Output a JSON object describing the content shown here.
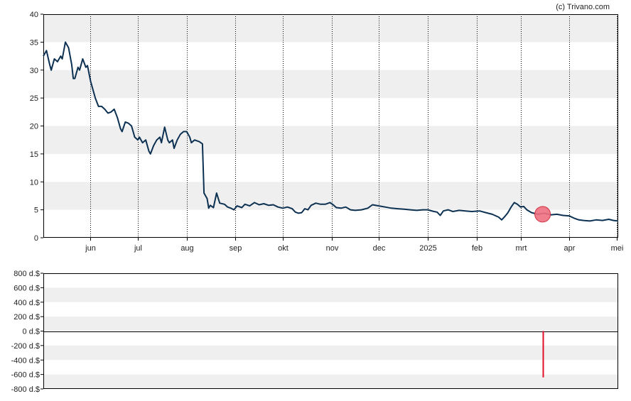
{
  "credit": "(c) Trivano.com",
  "colors": {
    "price_line": "#0d3152",
    "band": "#efefef",
    "marker_fill": "#f07080",
    "marker_stroke": "#d03040",
    "volume_bar": "#e0102a",
    "axis": "#000000"
  },
  "chart_data": [
    {
      "type": "line",
      "ylim": [
        0,
        40
      ],
      "y_ticks": [
        0,
        5,
        10,
        15,
        20,
        25,
        30,
        35,
        40
      ],
      "x_range": [
        "2024-05-02",
        "2025-05-02"
      ],
      "x_ticks": [
        {
          "label": "jun",
          "date": "2024-06-01"
        },
        {
          "label": "jul",
          "date": "2024-07-01"
        },
        {
          "label": "aug",
          "date": "2024-08-01"
        },
        {
          "label": "sep",
          "date": "2024-09-01"
        },
        {
          "label": "okt",
          "date": "2024-10-01"
        },
        {
          "label": "nov",
          "date": "2024-11-01"
        },
        {
          "label": "dec",
          "date": "2024-12-01"
        },
        {
          "label": "2025",
          "date": "2025-01-01"
        },
        {
          "label": "feb",
          "date": "2025-02-01"
        },
        {
          "label": "mrt",
          "date": "2025-03-01"
        },
        {
          "label": "apr",
          "date": "2025-04-01"
        },
        {
          "label": "mei",
          "date": "2025-05-01"
        }
      ],
      "grid": true,
      "series": [
        {
          "points": [
            [
              "2024-05-02",
              32.5
            ],
            [
              "2024-05-04",
              33.5
            ],
            [
              "2024-05-06",
              31.0
            ],
            [
              "2024-05-07",
              30.0
            ],
            [
              "2024-05-09",
              32.0
            ],
            [
              "2024-05-11",
              31.5
            ],
            [
              "2024-05-13",
              32.5
            ],
            [
              "2024-05-14",
              32.0
            ],
            [
              "2024-05-16",
              35.0
            ],
            [
              "2024-05-18",
              34.0
            ],
            [
              "2024-05-20",
              31.0
            ],
            [
              "2024-05-21",
              28.5
            ],
            [
              "2024-05-22",
              28.5
            ],
            [
              "2024-05-24",
              30.5
            ],
            [
              "2024-05-25",
              30.0
            ],
            [
              "2024-05-27",
              32.0
            ],
            [
              "2024-05-29",
              30.5
            ],
            [
              "2024-05-30",
              30.8
            ],
            [
              "2024-06-01",
              28.0
            ],
            [
              "2024-06-04",
              25.0
            ],
            [
              "2024-06-06",
              23.5
            ],
            [
              "2024-06-08",
              23.5
            ],
            [
              "2024-06-10",
              23.0
            ],
            [
              "2024-06-12",
              22.3
            ],
            [
              "2024-06-14",
              22.5
            ],
            [
              "2024-06-16",
              23.0
            ],
            [
              "2024-06-18",
              21.5
            ],
            [
              "2024-06-20",
              19.5
            ],
            [
              "2024-06-21",
              19.0
            ],
            [
              "2024-06-23",
              20.7
            ],
            [
              "2024-06-25",
              20.5
            ],
            [
              "2024-06-27",
              20.0
            ],
            [
              "2024-06-29",
              18.0
            ],
            [
              "2024-07-01",
              17.5
            ],
            [
              "2024-07-02",
              18.0
            ],
            [
              "2024-07-04",
              17.0
            ],
            [
              "2024-07-06",
              17.5
            ],
            [
              "2024-07-08",
              15.5
            ],
            [
              "2024-07-09",
              15.0
            ],
            [
              "2024-07-11",
              16.5
            ],
            [
              "2024-07-13",
              17.5
            ],
            [
              "2024-07-15",
              18.0
            ],
            [
              "2024-07-16",
              17.0
            ],
            [
              "2024-07-18",
              19.8
            ],
            [
              "2024-07-20",
              17.5
            ],
            [
              "2024-07-21",
              17.0
            ],
            [
              "2024-07-23",
              17.5
            ],
            [
              "2024-07-24",
              16.0
            ],
            [
              "2024-07-26",
              17.5
            ],
            [
              "2024-07-28",
              18.5
            ],
            [
              "2024-07-30",
              19.0
            ],
            [
              "2024-08-01",
              19.0
            ],
            [
              "2024-08-03",
              18.0
            ],
            [
              "2024-08-04",
              17.0
            ],
            [
              "2024-08-06",
              17.5
            ],
            [
              "2024-08-09",
              17.2
            ],
            [
              "2024-08-11",
              16.8
            ],
            [
              "2024-08-12",
              8.0
            ],
            [
              "2024-08-14",
              7.0
            ],
            [
              "2024-08-15",
              5.3
            ],
            [
              "2024-08-16",
              5.8
            ],
            [
              "2024-08-18",
              5.4
            ],
            [
              "2024-08-20",
              8.0
            ],
            [
              "2024-08-22",
              6.2
            ],
            [
              "2024-08-25",
              6.0
            ],
            [
              "2024-08-27",
              5.5
            ],
            [
              "2024-08-29",
              5.3
            ],
            [
              "2024-08-31",
              5.0
            ],
            [
              "2024-09-02",
              5.7
            ],
            [
              "2024-09-05",
              5.4
            ],
            [
              "2024-09-07",
              6.0
            ],
            [
              "2024-09-10",
              5.7
            ],
            [
              "2024-09-13",
              6.3
            ],
            [
              "2024-09-16",
              5.9
            ],
            [
              "2024-09-19",
              6.1
            ],
            [
              "2024-09-22",
              5.8
            ],
            [
              "2024-09-25",
              5.9
            ],
            [
              "2024-09-28",
              5.5
            ],
            [
              "2024-10-01",
              5.3
            ],
            [
              "2024-10-04",
              5.5
            ],
            [
              "2024-10-07",
              5.2
            ],
            [
              "2024-10-09",
              4.6
            ],
            [
              "2024-10-11",
              4.4
            ],
            [
              "2024-10-13",
              4.5
            ],
            [
              "2024-10-15",
              5.2
            ],
            [
              "2024-10-17",
              5.0
            ],
            [
              "2024-10-19",
              5.8
            ],
            [
              "2024-10-22",
              6.2
            ],
            [
              "2024-10-25",
              6.0
            ],
            [
              "2024-10-28",
              6.0
            ],
            [
              "2024-10-31",
              6.3
            ],
            [
              "2024-11-02",
              5.9
            ],
            [
              "2024-11-04",
              5.4
            ],
            [
              "2024-11-07",
              5.3
            ],
            [
              "2024-11-10",
              5.5
            ],
            [
              "2024-11-13",
              5.0
            ],
            [
              "2024-11-16",
              4.9
            ],
            [
              "2024-11-20",
              5.0
            ],
            [
              "2024-11-24",
              5.3
            ],
            [
              "2024-11-27",
              5.9
            ],
            [
              "2024-12-01",
              5.7
            ],
            [
              "2024-12-05",
              5.5
            ],
            [
              "2024-12-09",
              5.3
            ],
            [
              "2024-12-13",
              5.2
            ],
            [
              "2024-12-17",
              5.1
            ],
            [
              "2024-12-21",
              5.0
            ],
            [
              "2024-12-25",
              4.9
            ],
            [
              "2024-12-29",
              5.0
            ],
            [
              "2025-01-01",
              5.0
            ],
            [
              "2025-01-05",
              4.7
            ],
            [
              "2025-01-07",
              4.6
            ],
            [
              "2025-01-09",
              4.0
            ],
            [
              "2025-01-11",
              4.8
            ],
            [
              "2025-01-14",
              5.0
            ],
            [
              "2025-01-17",
              4.7
            ],
            [
              "2025-01-21",
              4.9
            ],
            [
              "2025-01-25",
              4.8
            ],
            [
              "2025-01-29",
              4.7
            ],
            [
              "2025-02-03",
              4.8
            ],
            [
              "2025-02-07",
              4.5
            ],
            [
              "2025-02-11",
              4.2
            ],
            [
              "2025-02-15",
              3.7
            ],
            [
              "2025-02-17",
              3.2
            ],
            [
              "2025-02-19",
              3.8
            ],
            [
              "2025-02-21",
              4.5
            ],
            [
              "2025-02-23",
              5.5
            ],
            [
              "2025-02-25",
              6.3
            ],
            [
              "2025-02-27",
              6.0
            ],
            [
              "2025-03-01",
              5.5
            ],
            [
              "2025-03-03",
              5.6
            ],
            [
              "2025-03-05",
              5.0
            ],
            [
              "2025-03-08",
              4.5
            ],
            [
              "2025-03-12",
              4.2
            ],
            [
              "2025-03-16",
              4.4
            ],
            [
              "2025-03-20",
              4.1
            ],
            [
              "2025-03-24",
              4.2
            ],
            [
              "2025-03-28",
              4.0
            ],
            [
              "2025-04-01",
              3.9
            ],
            [
              "2025-04-04",
              3.5
            ],
            [
              "2025-04-07",
              3.2
            ],
            [
              "2025-04-10",
              3.1
            ],
            [
              "2025-04-14",
              3.0
            ],
            [
              "2025-04-18",
              3.2
            ],
            [
              "2025-04-22",
              3.1
            ],
            [
              "2025-04-26",
              3.3
            ],
            [
              "2025-04-29",
              3.1
            ],
            [
              "2025-05-02",
              3.0
            ]
          ]
        }
      ],
      "markers": [
        {
          "date": "2025-03-15",
          "value": 4.2
        }
      ]
    },
    {
      "type": "bar",
      "ylim": [
        -800,
        800
      ],
      "y_ticks": [
        {
          "value": 800,
          "label": "800 d.$"
        },
        {
          "value": 600,
          "label": "600 d.$"
        },
        {
          "value": 400,
          "label": "400 d.$"
        },
        {
          "value": 200,
          "label": "200 d.$"
        },
        {
          "value": 0,
          "label": "0 d.$"
        },
        {
          "value": -200,
          "label": "-200 d.$"
        },
        {
          "value": -400,
          "label": "-400 d.$"
        },
        {
          "value": -600,
          "label": "-600 d.$"
        },
        {
          "value": -800,
          "label": "-800 d.$"
        }
      ],
      "x_range": [
        "2024-05-02",
        "2025-05-02"
      ],
      "grid": true,
      "bars": [
        {
          "date": "2025-03-15",
          "value": -640
        }
      ]
    }
  ]
}
